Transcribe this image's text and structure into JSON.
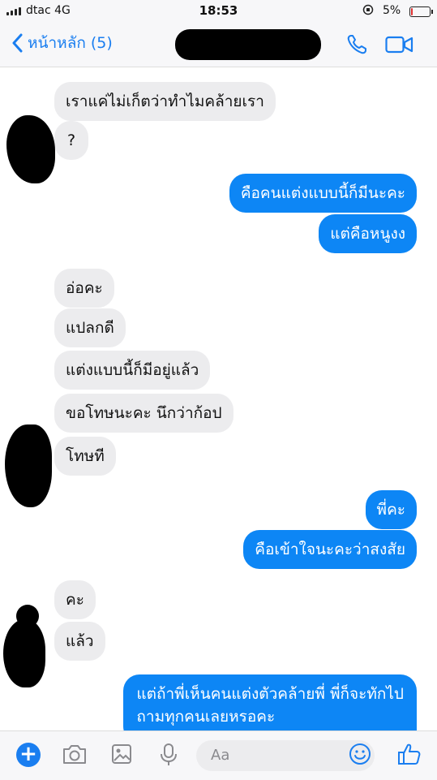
{
  "status_bar": {
    "carrier": "dtac  4G",
    "time": "18:53",
    "battery_percent": "5%",
    "battery_level": 0.05,
    "lock_icon": "rotation-lock-icon"
  },
  "nav": {
    "back_label": "หน้าหลัก (5)",
    "back_icon": "chevron-left-icon",
    "call_icon": "phone-icon",
    "video_icon": "video-camera-icon"
  },
  "messages": [
    {
      "side": "in",
      "text": "เราแค่ไม่เก็ตว่าทำไมคล้ายเรา"
    },
    {
      "side": "in",
      "text": "?"
    },
    {
      "side": "out",
      "text": "คือคนแต่งแบบนี้ก็มีนะคะ"
    },
    {
      "side": "out",
      "text": "แต่คือหนูงง"
    },
    {
      "side": "in",
      "text": "อ่อคะ"
    },
    {
      "side": "in",
      "text": "แปลกดี"
    },
    {
      "side": "in",
      "text": "แต่งแบบนี้ก็มีอยู่แล้ว"
    },
    {
      "side": "in",
      "text": "ขอโทษนะคะ นึกว่าก้อป"
    },
    {
      "side": "in",
      "text": "โทษที"
    },
    {
      "side": "out",
      "text": "พี่คะ"
    },
    {
      "side": "out",
      "text": "คือเข้าใจนะคะว่าสงสัย"
    },
    {
      "side": "in",
      "text": "คะ"
    },
    {
      "side": "in",
      "text": "แล้ว"
    },
    {
      "side": "out",
      "text": "แต่ถ้าพี่เห็นคนแต่งตัวคล้ายพี่ พี่ก็จะทักไป"
    },
    {
      "side": "out",
      "text": "ถามทุกคนเลยหรอคะ"
    }
  ],
  "composer": {
    "placeholder": "Aa",
    "icons": [
      "plus-icon",
      "camera-icon",
      "image-icon",
      "microphone-icon",
      "emoji-icon",
      "thumbs-up-icon"
    ]
  },
  "colors": {
    "accent": "#1a7ef0",
    "outgoing_bubble": "#0d86f5",
    "incoming_bubble": "#ececee"
  }
}
